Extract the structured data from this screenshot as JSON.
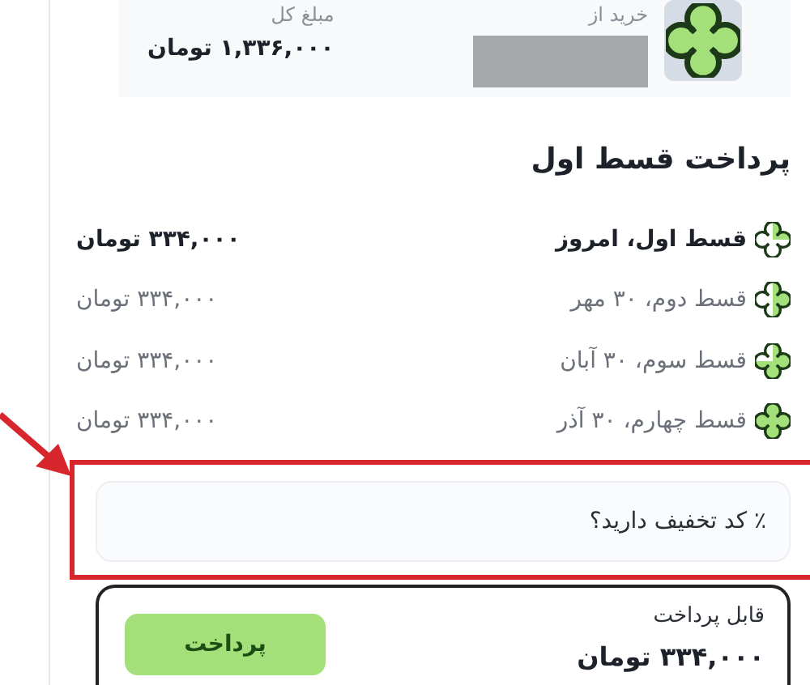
{
  "merchant": {
    "label": "خرید از",
    "total_label": "مبلغ کل",
    "total": "۱,۳۳۶,۰۰۰ تومان"
  },
  "plan": {
    "title": "پرداخت قسط اول",
    "installments": [
      {
        "label": "قسط اول، امروز",
        "amount": "۳۳۴,۰۰۰ تومان",
        "current": true
      },
      {
        "label": "قسط دوم، ۳۰ مهر",
        "amount": "۳۳۴,۰۰۰ تومان",
        "current": false
      },
      {
        "label": "قسط سوم، ۳۰ آبان",
        "amount": "۳۳۴,۰۰۰ تومان",
        "current": false
      },
      {
        "label": "قسط چهارم، ۳۰ آذر",
        "amount": "۳۳۴,۰۰۰ تومان",
        "current": false
      }
    ]
  },
  "discount": {
    "label": "٪ کد تخفیف دارید؟"
  },
  "payment": {
    "label": "قابل پرداخت",
    "amount": "۳۳۴,۰۰۰ تومان",
    "button": "پرداخت"
  }
}
